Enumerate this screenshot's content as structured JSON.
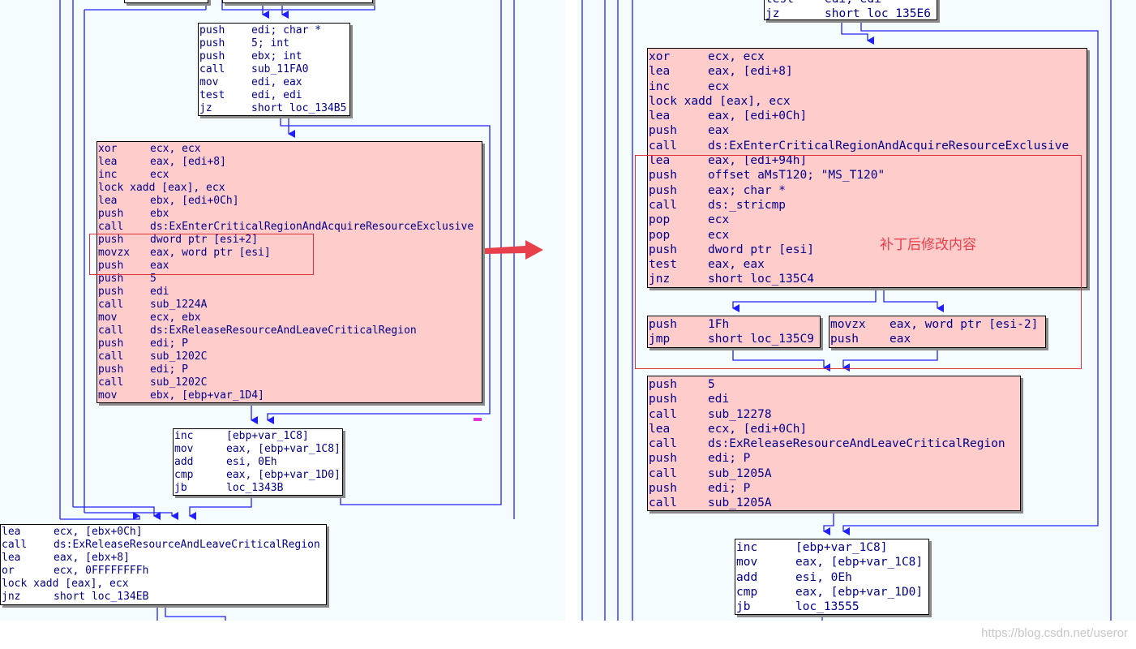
{
  "colors": {
    "background": "#f4fcfd",
    "block_white": "#ffffff",
    "block_pink": "#ffcccc",
    "edge": "#1f1fff",
    "text": "#00008b",
    "annotation": "#e8404a"
  },
  "left_graph": {
    "top_stub": [
      {
        "m": "",
        "o": ""
      }
    ],
    "block_1": [
      {
        "m": "push",
        "o": "edi; char *"
      },
      {
        "m": "push",
        "o": "5; int"
      },
      {
        "m": "push",
        "o": "ebx; int"
      },
      {
        "m": "call",
        "o": "sub_11FA0"
      },
      {
        "m": "mov",
        "o": "edi, eax"
      },
      {
        "m": "test",
        "o": "edi, edi"
      },
      {
        "m": "jz",
        "o": "short loc_134B5"
      }
    ],
    "block_2": [
      {
        "m": "xor",
        "o": "ecx, ecx"
      },
      {
        "m": "lea",
        "o": "eax, [edi+8]"
      },
      {
        "m": "inc",
        "o": "ecx"
      },
      {
        "m": "lock xadd [eax], ecx",
        "o": ""
      },
      {
        "m": "lea",
        "o": "ebx, [edi+0Ch]"
      },
      {
        "m": "push",
        "o": "ebx"
      },
      {
        "m": "call",
        "o": "ds:ExEnterCriticalRegionAndAcquireResourceExclusive"
      },
      {
        "m": "push",
        "o": "dword ptr [esi+2]"
      },
      {
        "m": "movzx",
        "o": "eax, word ptr [esi]"
      },
      {
        "m": "push",
        "o": "eax"
      },
      {
        "m": "push",
        "o": "5"
      },
      {
        "m": "push",
        "o": "edi"
      },
      {
        "m": "call",
        "o": "sub_1224A"
      },
      {
        "m": "mov",
        "o": "ecx, ebx"
      },
      {
        "m": "call",
        "o": "ds:ExReleaseResourceAndLeaveCriticalRegion"
      },
      {
        "m": "push",
        "o": "edi; P"
      },
      {
        "m": "call",
        "o": "sub_1202C"
      },
      {
        "m": "push",
        "o": "edi; P"
      },
      {
        "m": "call",
        "o": "sub_1202C"
      },
      {
        "m": "mov",
        "o": "ebx, [ebp+var_1D4]"
      }
    ],
    "block_3": [
      {
        "m": "inc",
        "o": "[ebp+var_1C8]"
      },
      {
        "m": "mov",
        "o": "eax, [ebp+var_1C8]"
      },
      {
        "m": "add",
        "o": "esi, 0Eh"
      },
      {
        "m": "cmp",
        "o": "eax, [ebp+var_1D0]"
      },
      {
        "m": "jb",
        "o": "loc_1343B"
      }
    ],
    "block_4": [
      {
        "m": "lea",
        "o": "ecx, [ebx+0Ch]"
      },
      {
        "m": "call",
        "o": "ds:ExReleaseResourceAndLeaveCriticalRegion"
      },
      {
        "m": "lea",
        "o": "eax, [ebx+8]"
      },
      {
        "m": "or",
        "o": "ecx, 0FFFFFFFFh"
      },
      {
        "m": "lock xadd [eax], ecx",
        "o": ""
      },
      {
        "m": "jnz",
        "o": "short loc_134EB"
      }
    ]
  },
  "right_graph": {
    "block_0": [
      {
        "m": "test",
        "o": "edi, edi"
      },
      {
        "m": "jz",
        "o": "short loc_135E6"
      }
    ],
    "block_1": [
      {
        "m": "xor",
        "o": "ecx, ecx"
      },
      {
        "m": "lea",
        "o": "eax, [edi+8]"
      },
      {
        "m": "inc",
        "o": "ecx"
      },
      {
        "m": "lock xadd [eax], ecx",
        "o": ""
      },
      {
        "m": "lea",
        "o": "eax, [edi+0Ch]"
      },
      {
        "m": "push",
        "o": "eax"
      },
      {
        "m": "call",
        "o": "ds:ExEnterCriticalRegionAndAcquireResourceExclusive"
      },
      {
        "m": "lea",
        "o": "eax, [edi+94h]"
      },
      {
        "m": "push",
        "o": "offset aMsT120; \"MS_T120\""
      },
      {
        "m": "push",
        "o": "eax; char *"
      },
      {
        "m": "call",
        "o": "ds:_stricmp"
      },
      {
        "m": "pop",
        "o": "ecx"
      },
      {
        "m": "pop",
        "o": "ecx"
      },
      {
        "m": "push",
        "o": "dword ptr [esi]"
      },
      {
        "m": "test",
        "o": "eax, eax"
      },
      {
        "m": "jnz",
        "o": "short loc_135C4"
      }
    ],
    "block_2a": [
      {
        "m": "push",
        "o": "1Fh"
      },
      {
        "m": "jmp",
        "o": "short loc_135C9"
      }
    ],
    "block_2b": [
      {
        "m": "movzx",
        "o": "eax, word ptr [esi-2]"
      },
      {
        "m": "push",
        "o": "eax"
      }
    ],
    "block_3": [
      {
        "m": "push",
        "o": "5"
      },
      {
        "m": "push",
        "o": "edi"
      },
      {
        "m": "call",
        "o": "sub_12278"
      },
      {
        "m": "lea",
        "o": "ecx, [edi+0Ch]"
      },
      {
        "m": "call",
        "o": "ds:ExReleaseResourceAndLeaveCriticalRegion"
      },
      {
        "m": "push",
        "o": "edi; P"
      },
      {
        "m": "call",
        "o": "sub_1205A"
      },
      {
        "m": "push",
        "o": "edi; P"
      },
      {
        "m": "call",
        "o": "sub_1205A"
      }
    ],
    "block_4": [
      {
        "m": "inc",
        "o": "[ebp+var_1C8]"
      },
      {
        "m": "mov",
        "o": "eax, [ebp+var_1C8]"
      },
      {
        "m": "add",
        "o": "esi, 0Eh"
      },
      {
        "m": "cmp",
        "o": "eax, [ebp+var_1D0]"
      },
      {
        "m": "jb",
        "o": "loc_13555"
      }
    ]
  },
  "annotation": "补丁后修改内容",
  "watermark": "https://blog.csdn.net/useror"
}
